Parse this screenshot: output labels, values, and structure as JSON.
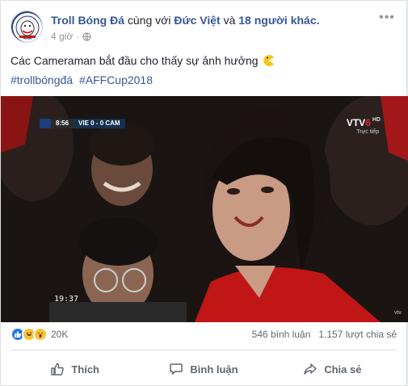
{
  "post": {
    "page_name": "Troll Bóng Đá",
    "with_text": "cùng với",
    "tagged_person": "Đức Việt",
    "and_text": "và",
    "others_text": "18 người khác.",
    "time": "4 giờ",
    "time_separator": "·",
    "caption": "Các Cameraman bắt đầu cho thấy sự ảnh hưởng",
    "hashtags": [
      "#trollbóngđá",
      "#AFFCup2018"
    ]
  },
  "video": {
    "score_time": "8:56",
    "score_teams": "VIE  0 - 0  CAM",
    "channel_vtv": "VTV",
    "channel_num": "6",
    "channel_hd": "HD",
    "live_label": "Trực tiếp",
    "clock": "19:37",
    "watermark": "vtv"
  },
  "stats": {
    "reaction_count": "20K",
    "comments": "546 bình luận",
    "shares": "1.157 lượt chia sẻ"
  },
  "actions": {
    "like": "Thích",
    "comment": "Bình luận",
    "share": "Chia sẻ"
  },
  "colors": {
    "link": "#365899",
    "secondary": "#606770",
    "like_blue": "#2078f4"
  },
  "icons": {
    "more": "ellipsis-icon",
    "privacy": "globe-icon",
    "caption_emoji": "pacman-emoji-icon",
    "like": "thumbs-up-icon",
    "comment": "speech-bubble-icon",
    "share": "share-arrow-icon"
  }
}
